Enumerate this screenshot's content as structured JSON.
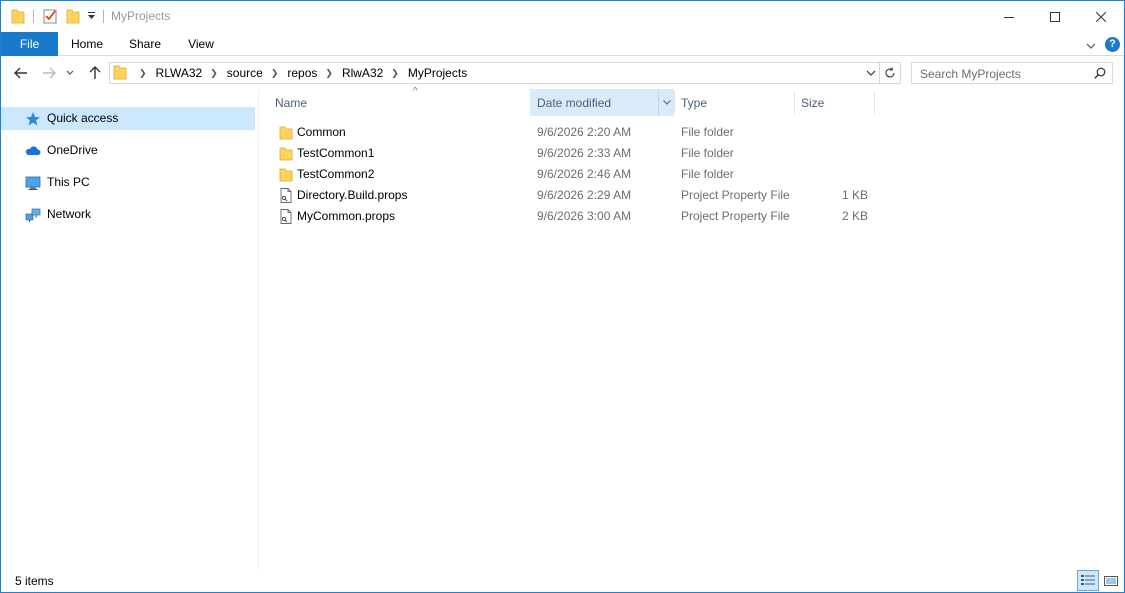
{
  "window": {
    "title": "MyProjects",
    "caption_buttons": [
      "minimize-icon",
      "maximize-icon",
      "close-icon"
    ]
  },
  "ribbon": {
    "tabs": [
      {
        "label": "File",
        "active": true
      },
      {
        "label": "Home"
      },
      {
        "label": "Share"
      },
      {
        "label": "View"
      }
    ],
    "help_label": "?"
  },
  "nav": {
    "breadcrumbs": [
      "RLWA32",
      "source",
      "repos",
      "RlwA32",
      "MyProjects"
    ],
    "search_placeholder": "Search MyProjects"
  },
  "sidebar": {
    "items": [
      {
        "label": "Quick access",
        "icon": "star-icon",
        "selected": true
      },
      {
        "label": "OneDrive",
        "icon": "cloud-icon"
      },
      {
        "label": "This PC",
        "icon": "computer-icon"
      },
      {
        "label": "Network",
        "icon": "network-icon"
      }
    ]
  },
  "columns": {
    "name": "Name",
    "date": "Date modified",
    "type": "Type",
    "size": "Size",
    "sort_caret": "^"
  },
  "files": [
    {
      "name": "Common",
      "date": "9/6/2026 2:20 AM",
      "type": "File folder",
      "size": "",
      "icon": "folder-icon"
    },
    {
      "name": "TestCommon1",
      "date": "9/6/2026 2:33 AM",
      "type": "File folder",
      "size": "",
      "icon": "folder-icon"
    },
    {
      "name": "TestCommon2",
      "date": "9/6/2026 2:46 AM",
      "type": "File folder",
      "size": "",
      "icon": "folder-icon"
    },
    {
      "name": "Directory.Build.props",
      "date": "9/6/2026 2:29 AM",
      "type": "Project Property File",
      "size": "1 KB",
      "icon": "file-icon"
    },
    {
      "name": "MyCommon.props",
      "date": "9/6/2026 3:00 AM",
      "type": "Project Property File",
      "size": "2 KB",
      "icon": "file-icon"
    }
  ],
  "status": {
    "item_count": "5 items"
  },
  "colors": {
    "accent": "#1979ca",
    "selected_bg": "#cce8ff",
    "folder_yellow": "#ffd35c"
  }
}
